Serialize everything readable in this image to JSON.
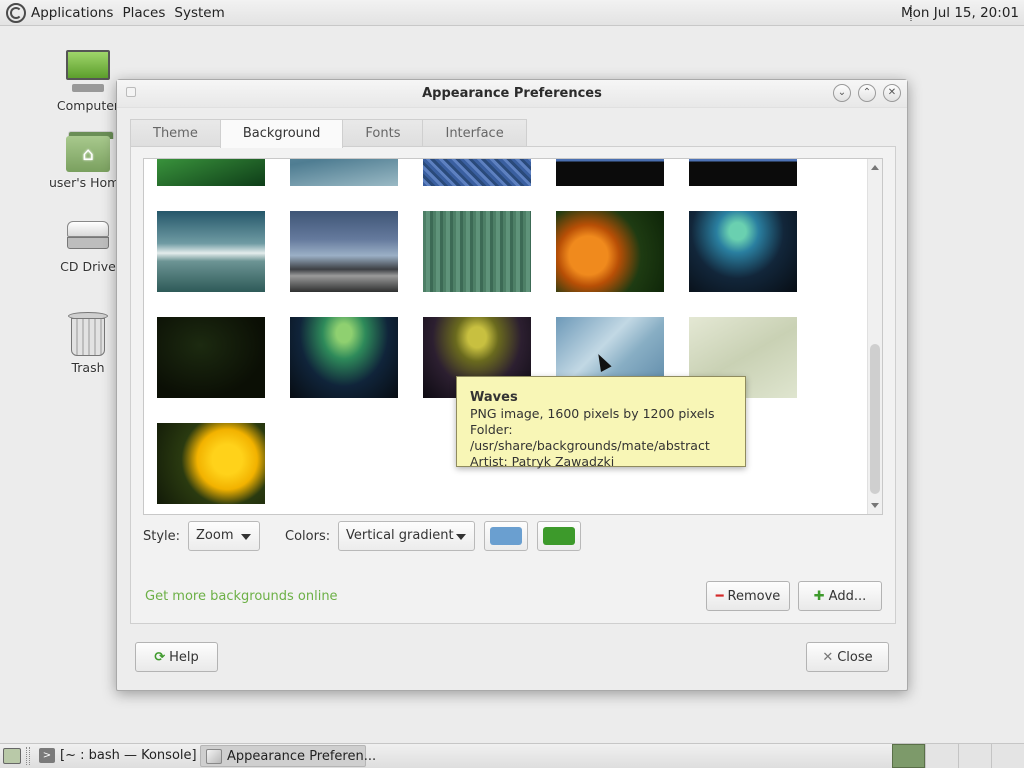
{
  "top_panel": {
    "menus": [
      "Applications",
      "Places",
      "System"
    ],
    "clock": "Mon Jul 15, 20:01"
  },
  "desktop": {
    "icons": [
      {
        "label": "Computer",
        "icon": "computer-icon"
      },
      {
        "label": "user's Home",
        "icon": "home-folder-icon"
      },
      {
        "label": "CD Drive",
        "icon": "cd-drive-icon"
      },
      {
        "label": "Trash",
        "icon": "trash-icon"
      }
    ]
  },
  "window": {
    "title": "Appearance Preferences",
    "tabs": [
      "Theme",
      "Background",
      "Fonts",
      "Interface"
    ],
    "active_tab": "Background",
    "backgrounds": [
      {
        "name": "green-leaf"
      },
      {
        "name": "blue-waves-top"
      },
      {
        "name": "blue-texture"
      },
      {
        "name": "blue-dots-dark"
      },
      {
        "name": "blue-dots-dark-2"
      },
      {
        "name": "white-waves"
      },
      {
        "name": "storm-clouds"
      },
      {
        "name": "green-stripes"
      },
      {
        "name": "orange-dandelion"
      },
      {
        "name": "aurora-blue"
      },
      {
        "name": "dark-green"
      },
      {
        "name": "aurora-green"
      },
      {
        "name": "aurora-yellow"
      },
      {
        "name": "Waves"
      },
      {
        "name": "light-leaf"
      },
      {
        "name": "yellow-flower"
      }
    ],
    "style_label": "Style:",
    "style_value": "Zoom",
    "colors_label": "Colors:",
    "colors_value": "Vertical gradient",
    "primary_color": "#6a9fd0",
    "secondary_color": "#3d9a2b",
    "more_link": "Get more backgrounds online",
    "remove_label": "Remove",
    "add_label": "Add...",
    "help_label": "Help",
    "close_label": "Close"
  },
  "tooltip": {
    "title": "Waves",
    "line1": "PNG image, 1600 pixels by 1200 pixels",
    "line2": "Folder: /usr/share/backgrounds/mate/abstract",
    "line3": "Artist: Patryk Zawadzki"
  },
  "bottom_panel": {
    "tasks": [
      "[~ : bash — Konsole]",
      "Appearance Preferen..."
    ]
  },
  "colors": {
    "link": "#6cb046",
    "tooltip_bg": "#f8f6b6",
    "remove_icon": "#d42a2a",
    "add_icon": "#3e9a2c"
  }
}
